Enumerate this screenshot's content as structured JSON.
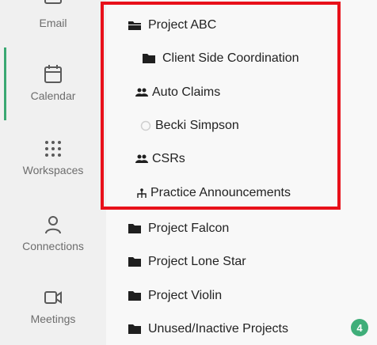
{
  "rail": {
    "items": [
      {
        "label": "Email",
        "icon": "email-icon"
      },
      {
        "label": "Calendar",
        "icon": "calendar-icon"
      },
      {
        "label": "Workspaces",
        "icon": "grid-icon"
      },
      {
        "label": "Connections",
        "icon": "person-icon"
      },
      {
        "label": "Meetings",
        "icon": "video-icon"
      }
    ],
    "active_accent": "#3aa872"
  },
  "tree": {
    "items": [
      {
        "label": "Project ABC",
        "icon": "folder-open-icon"
      },
      {
        "label": "Client Side Coordination",
        "icon": "folder-icon"
      },
      {
        "label": "Auto Claims",
        "icon": "group-icon"
      },
      {
        "label": "Becki Simpson",
        "icon": "status-circle-icon"
      },
      {
        "label": "CSRs",
        "icon": "group-icon"
      },
      {
        "label": "Practice Announcements",
        "icon": "hierarchy-icon"
      },
      {
        "label": "Project Falcon",
        "icon": "folder-icon"
      },
      {
        "label": "Project Lone Star",
        "icon": "folder-icon"
      },
      {
        "label": "Project Violin",
        "icon": "folder-icon"
      },
      {
        "label": "Unused/Inactive Projects",
        "icon": "folder-icon",
        "badge": "4"
      }
    ]
  },
  "colors": {
    "highlight_border": "#e8101a",
    "badge": "#3fae79"
  }
}
